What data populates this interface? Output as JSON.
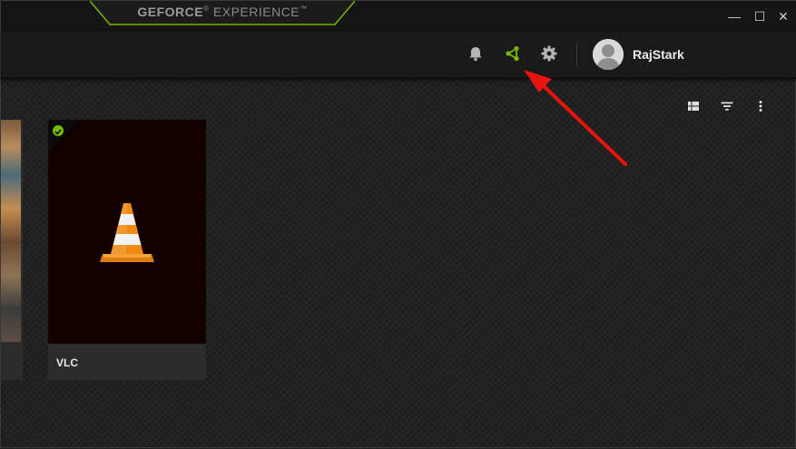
{
  "window": {
    "title_bold": "GEFORCE",
    "title_light": "EXPERIENCE",
    "controls": {
      "minimize": "—",
      "maximize": "☐",
      "close": "✕"
    }
  },
  "header": {
    "icons": [
      "bell-icon",
      "share-icon",
      "gear-icon"
    ],
    "user": {
      "name": "RajStark"
    }
  },
  "toolbar": {
    "icons": [
      "grid-view-icon",
      "filter-icon",
      "more-options-icon"
    ]
  },
  "games": [
    {
      "name": "",
      "partial": true
    },
    {
      "name": "VLC",
      "optimized": true
    }
  ],
  "colors": {
    "accent": "#76b900",
    "annotation_arrow": "#e8140f",
    "background": "#222222"
  }
}
